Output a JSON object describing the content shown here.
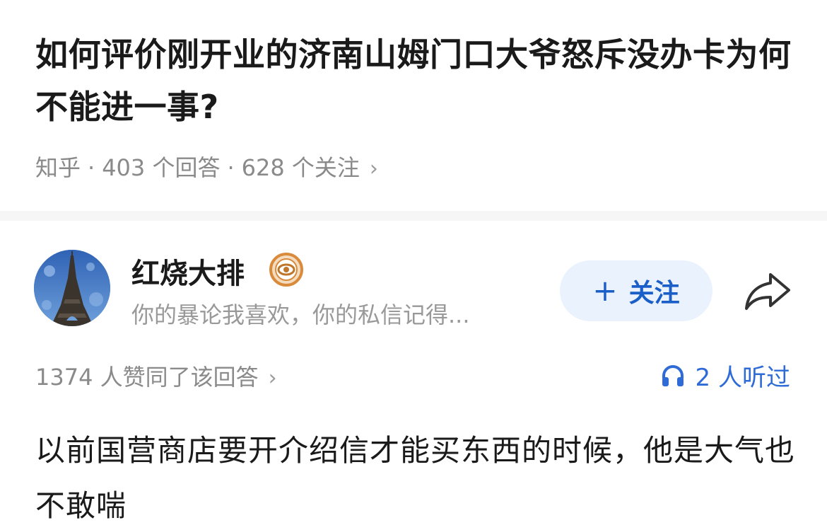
{
  "question": {
    "title": "如何评价刚开业的济南山姆门口大爷怒斥没办卡为何不能进一事?",
    "platform": "知乎",
    "answers_count": "403 个回答",
    "followers_count": "628 个关注",
    "separator": "·",
    "chevron": "›"
  },
  "author": {
    "name": "红烧大排",
    "bio": "你的暴论我喜欢，你的私信记得...",
    "avatar_icon": "eiffel-tower-avatar",
    "badge_icon": "eye-badge-icon"
  },
  "actions": {
    "follow_plus": "+",
    "follow_label": "关注",
    "share_icon": "share-arrow-icon"
  },
  "stats": {
    "agree_text": "1374 人赞同了该回答",
    "chevron": "›",
    "listen_icon": "headphone-icon",
    "listen_text": "2 人听过"
  },
  "answer": {
    "body": "以前国营商店要开介绍信才能买东西的时候，他是大气也不敢喘"
  },
  "colors": {
    "accent": "#1a5ec8",
    "follow_bg": "#eaf2fd",
    "listen": "#2e6bd6",
    "meta_gray": "#8a8a8a",
    "text_dark": "#1a1a1a",
    "badge_orange": "#d98a3a"
  }
}
